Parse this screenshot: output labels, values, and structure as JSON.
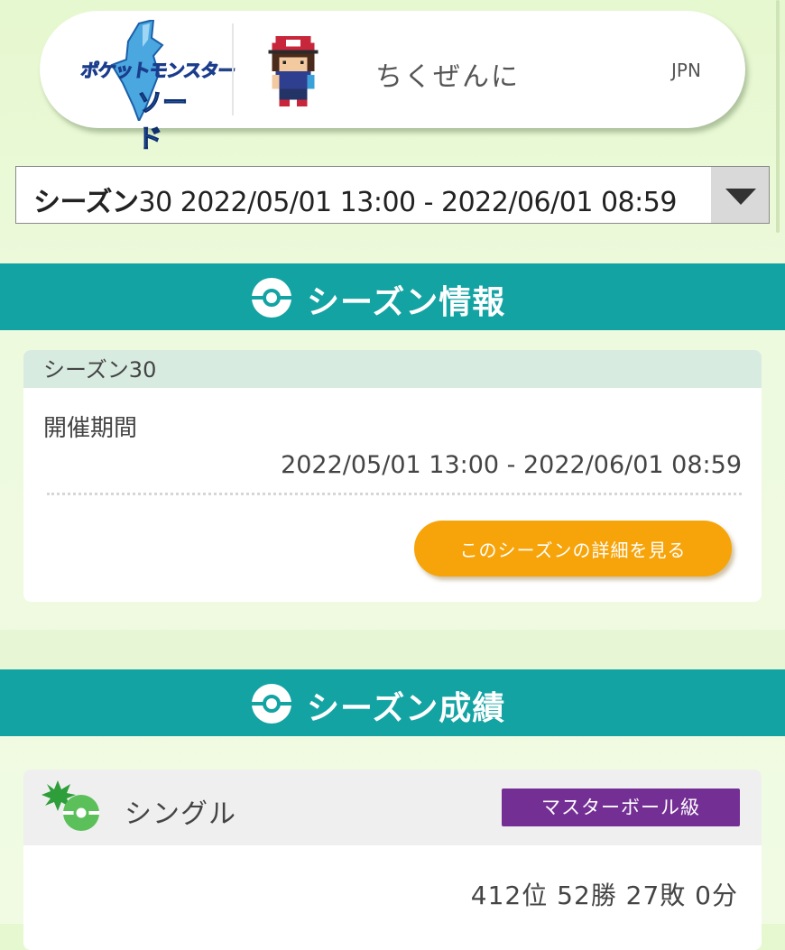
{
  "profile": {
    "game_logo_top": "ポケットモンスター",
    "game_logo_bottom": "ソード",
    "trainer_name": "ちくぜんに",
    "region": "JPN"
  },
  "season_select": {
    "label_bold": "シーズン",
    "label_rest": "30 2022/05/01 13:00 - 2022/06/01 08:59"
  },
  "season_info": {
    "header": "シーズン情報",
    "card_title": "シーズン30",
    "period_label": "開催期間",
    "period_value": "2022/05/01 13:00 - 2022/06/01 08:59",
    "detail_button": "このシーズンの詳細を見る"
  },
  "season_results": {
    "header": "シーズン成績",
    "battle_type": "シングル",
    "rank_class": "マスターボール級",
    "record": "412位 52勝 27敗 0分"
  },
  "colors": {
    "section_header": "#14a3a3",
    "button": "#f7a40a",
    "rank_badge": "#742f94",
    "background": "#e6f8cf"
  },
  "icons": [
    "pokeball-icon",
    "sword-logo",
    "trainer-avatar",
    "single-battle-icon",
    "dropdown-arrow-icon"
  ]
}
